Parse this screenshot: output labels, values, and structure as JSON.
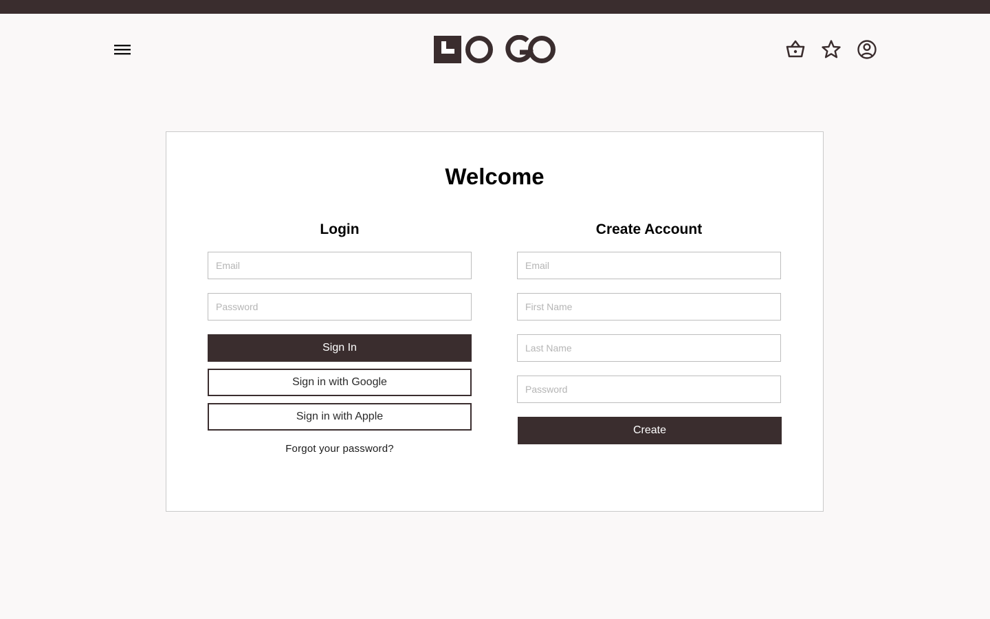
{
  "header": {
    "logo_text": "LOGO",
    "menu_icon": "hamburger-menu-icon",
    "cart_icon": "basket-icon",
    "favorites_icon": "star-icon",
    "account_icon": "user-circle-icon"
  },
  "page": {
    "title": "Welcome"
  },
  "login": {
    "heading": "Login",
    "email_placeholder": "Email",
    "password_placeholder": "Password",
    "sign_in_label": "Sign In",
    "google_label": "Sign in with Google",
    "apple_label": "Sign in with Apple",
    "forgot_label": "Forgot your password?"
  },
  "create_account": {
    "heading": "Create Account",
    "email_placeholder": "Email",
    "first_name_placeholder": "First Name",
    "last_name_placeholder": "Last Name",
    "password_placeholder": "Password",
    "create_label": "Create"
  },
  "colors": {
    "brand_dark": "#3a2d2e",
    "page_background": "#faf8f8",
    "card_background": "#ffffff"
  }
}
